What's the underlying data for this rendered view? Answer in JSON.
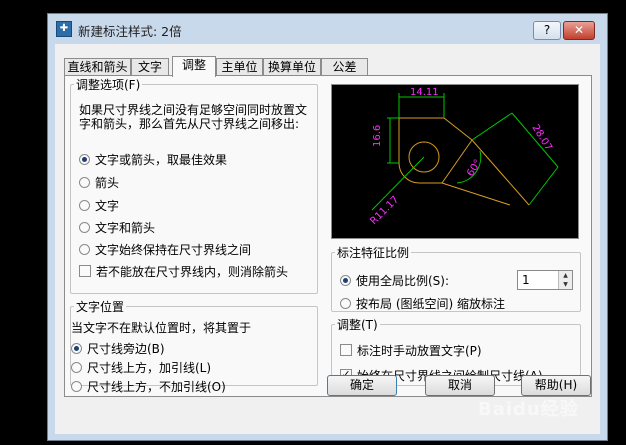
{
  "window": {
    "title": "新建标注样式: 2倍",
    "help_symbol": "?",
    "close_symbol": "✕"
  },
  "tabs": [
    {
      "label": "直线和箭头",
      "active": false
    },
    {
      "label": "文字",
      "active": false
    },
    {
      "label": "调整",
      "active": true
    },
    {
      "label": "主单位",
      "active": false
    },
    {
      "label": "换算单位",
      "active": false
    },
    {
      "label": "公差",
      "active": false
    }
  ],
  "fit_options": {
    "legend": "调整选项(F)",
    "description": "如果尺寸界线之间没有足够空间同时放置文字和箭头，那么首先从尺寸界线之间移出:",
    "radios": [
      {
        "label": "文字或箭头，取最佳效果",
        "selected": true
      },
      {
        "label": "箭头",
        "selected": false
      },
      {
        "label": "文字",
        "selected": false
      },
      {
        "label": "文字和箭头",
        "selected": false
      },
      {
        "label": "文字始终保持在尺寸界线之间",
        "selected": false
      }
    ],
    "checkbox": {
      "label": "若不能放在尺寸界线内，则消除箭头",
      "checked": false
    }
  },
  "text_placement": {
    "legend": "文字位置",
    "description": "当文字不在默认位置时，将其置于",
    "radios": [
      {
        "label": "尺寸线旁边(B)",
        "selected": true
      },
      {
        "label": "尺寸线上方，加引线(L)",
        "selected": false
      },
      {
        "label": "尺寸线上方，不加引线(O)",
        "selected": false
      }
    ]
  },
  "preview": {
    "dims": [
      "14.11",
      "16.6",
      "28.07",
      "60°",
      "R11.17"
    ],
    "colors": {
      "geometry": "#d79a24",
      "dimension": "#00c800",
      "text": "#ff2bff",
      "background": "#000000"
    }
  },
  "scale": {
    "legend": "标注特征比例",
    "use_overall_label": "使用全局比例(S):",
    "use_overall_selected": true,
    "overall_value": "1",
    "layout_label": "按布局 (图纸空间) 缩放标注",
    "layout_selected": false
  },
  "fine_tuning": {
    "legend": "调整(T)",
    "manual_label": "标注时手动放置文字(P)",
    "manual_checked": false,
    "always_draw_label": "始终在尺寸界线之间绘制尺寸线(A)",
    "always_draw_checked": true
  },
  "buttons": {
    "ok": "确定",
    "cancel": "取消",
    "help": "帮助(H)"
  },
  "watermark": "Baidu经验"
}
